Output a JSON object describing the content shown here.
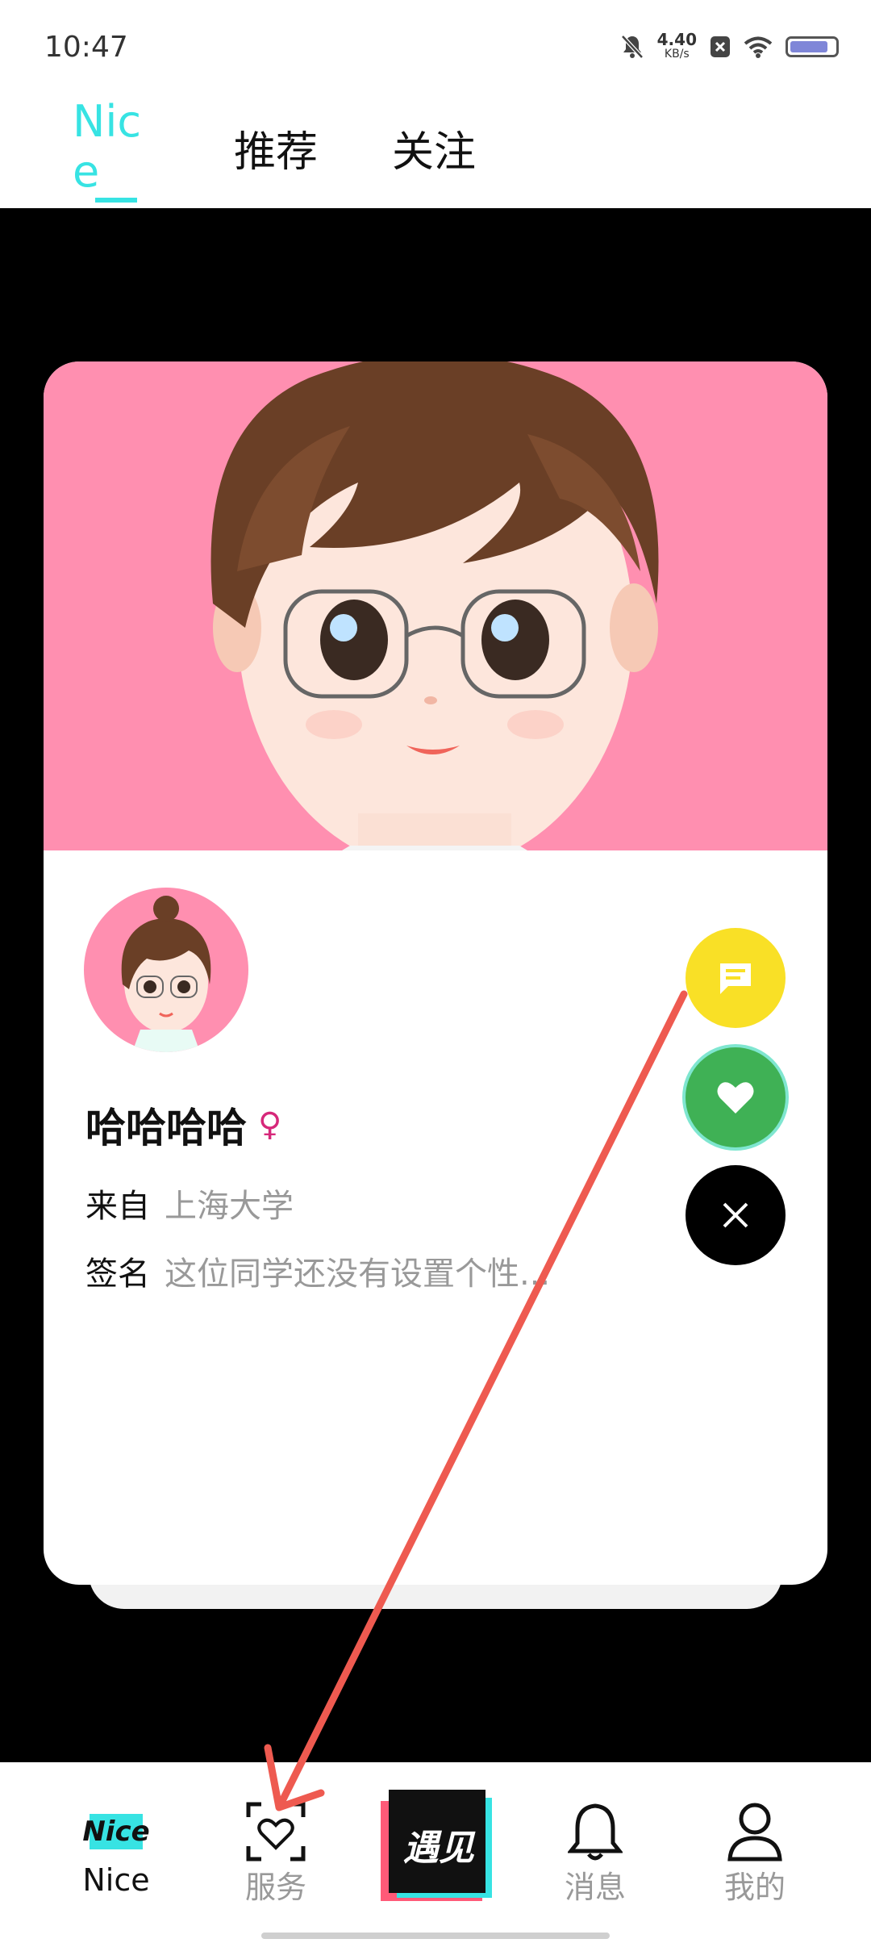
{
  "status_bar": {
    "time": "10:47",
    "net_speed_value": "4.40",
    "net_speed_unit": "KB/s"
  },
  "header": {
    "logo_line1": "Nic",
    "logo_line2": "e",
    "tabs": [
      "推荐",
      "关注"
    ]
  },
  "profile": {
    "name": "哈哈哈哈",
    "gender_symbol": "♀",
    "from_label": "来自",
    "from_value": "上海大学",
    "sign_label": "签名",
    "sign_value": "这位同学还没有设置个性..."
  },
  "actions": {
    "chat_icon": "chat-bubble-icon",
    "like_icon": "heart-icon",
    "close_icon": "close-icon"
  },
  "bottom_nav": {
    "items": [
      {
        "label": "Nice",
        "icon": "nice-logo-icon",
        "badge_text": "Nice"
      },
      {
        "label": "服务",
        "icon": "heart-scan-icon"
      },
      {
        "label": "",
        "icon": "meet-center-icon",
        "badge_text": "遇见"
      },
      {
        "label": "消息",
        "icon": "bell-icon"
      },
      {
        "label": "我的",
        "icon": "person-icon"
      }
    ]
  },
  "colors": {
    "accent": "#37e3e3",
    "hero_bg": "#ff8fb0",
    "chat": "#f9e026",
    "like": "#3fb155",
    "annotation_arrow": "#ee5a50"
  }
}
